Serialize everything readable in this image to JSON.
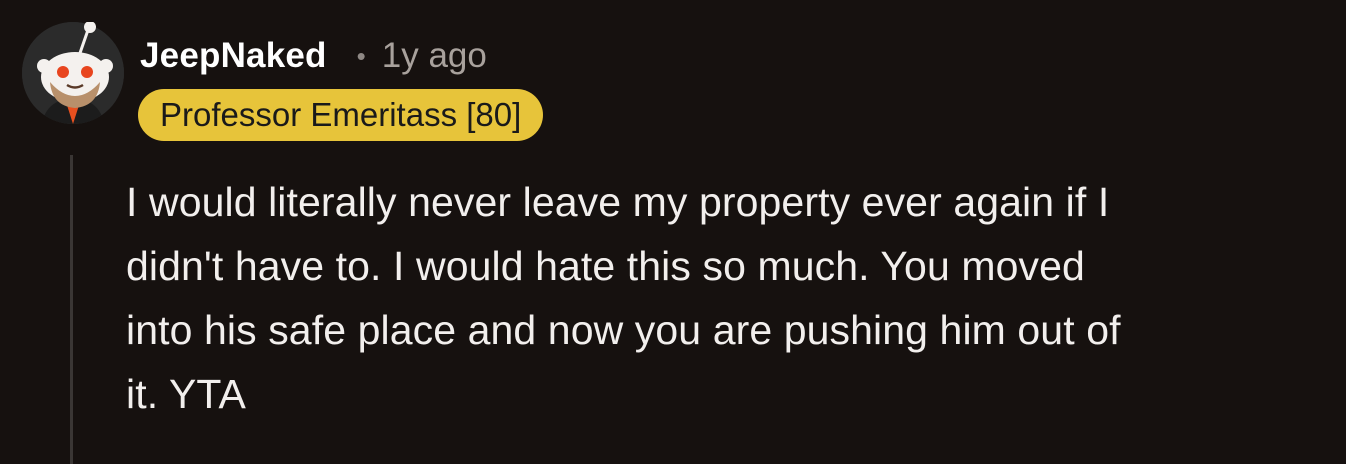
{
  "comment": {
    "author": "JeepNaked",
    "separator": "•",
    "age": "1y ago",
    "flair": "Professor Emeritass [80]",
    "body_lines": [
      "I would literally never leave my property ever again if I",
      "didn't have to. I would hate this so much. You moved",
      "into his safe place and now you are pushing him out of",
      "it. YTA"
    ]
  },
  "colors": {
    "background": "#16110f",
    "flair_background": "#e7c43a",
    "text": "#f2efed",
    "muted_text": "#a8a19c",
    "thread_line": "#3a3634"
  },
  "icons": {
    "avatar": "snoo-avatar-icon"
  }
}
